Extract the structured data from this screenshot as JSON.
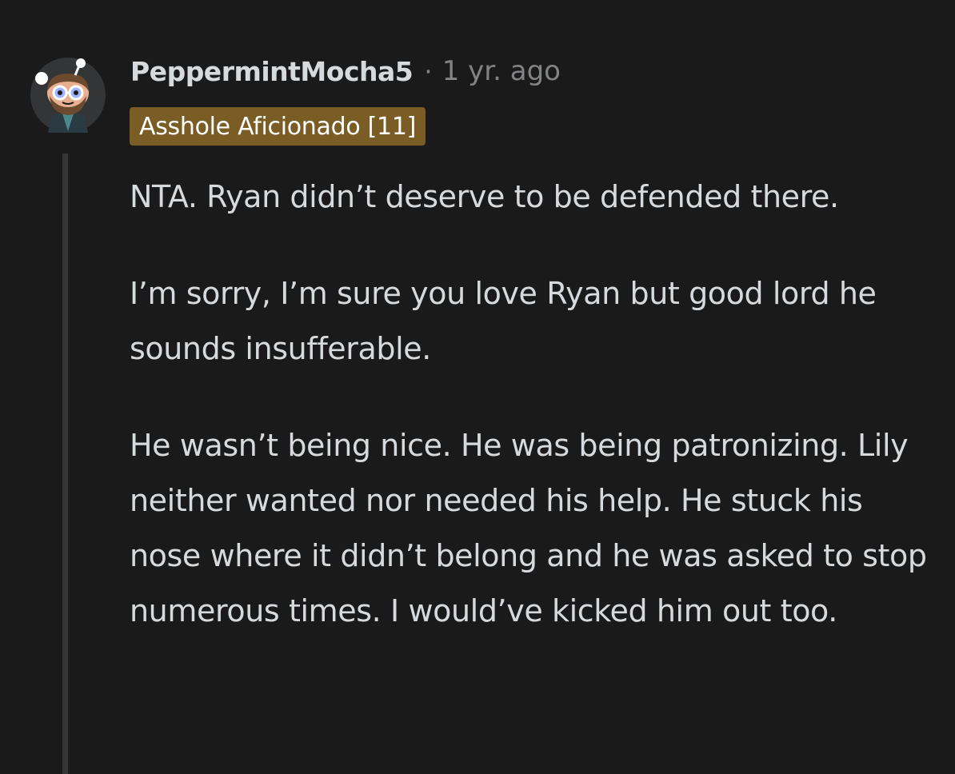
{
  "comment": {
    "author": "PeppermintMocha5",
    "separator": "·",
    "timestamp": "1 yr. ago",
    "flair": "Asshole Aficionado [11]",
    "avatar_icon": "snoo-avatar-icon",
    "paragraphs": [
      "NTA. Ryan didn’t deserve to be defended there.",
      "I’m sorry, I’m sure you love Ryan but good lord he sounds insufferable.",
      "He wasn’t being nice. He was being patronizing. Lily neither wanted nor needed his help. He stuck his nose where it didn’t belong and he was asked to stop numerous times. I would’ve kicked him out too."
    ]
  },
  "colors": {
    "background": "#1a1a1b",
    "text": "#d7dadc",
    "meta": "#818384",
    "flair_bg": "#7a5c25",
    "thread_line": "#343536"
  }
}
